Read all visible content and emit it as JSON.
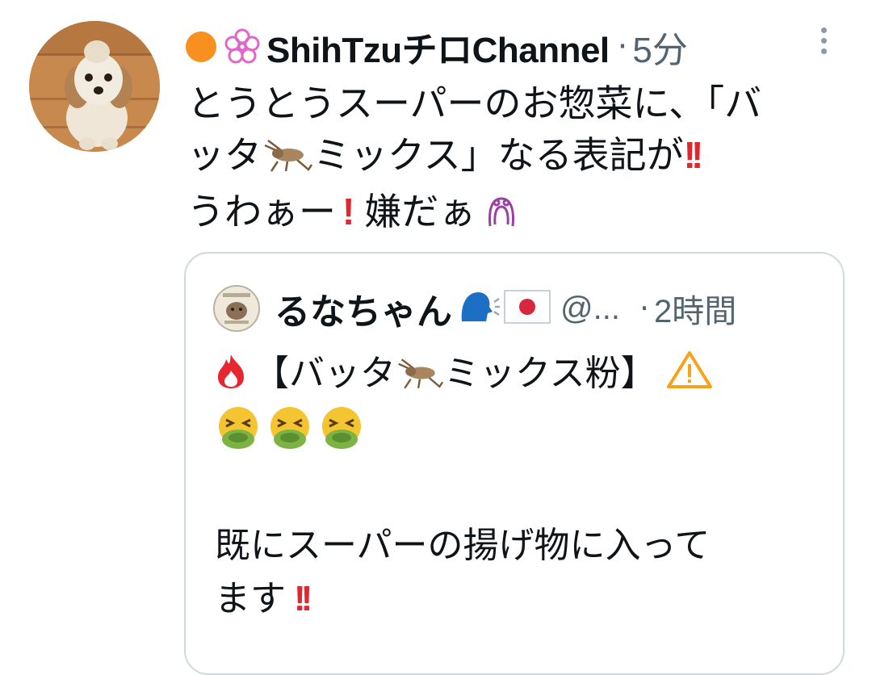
{
  "tweet": {
    "display_name": "ShihTzuチロChannel",
    "separator": "·",
    "time": "5分",
    "body_lines": [
      {
        "before": "とうとうスーパーのお惣菜に、「バ",
        "after": ""
      },
      {
        "before": "ッタ",
        "after": "ミックス」なる表記が"
      },
      {
        "before": "うわぁー",
        "after": "嫌だぁ"
      }
    ],
    "emojis": [
      "orange-circle-emoji",
      "cherry-blossom-emoji",
      "cricket-emoji",
      "double-exclamation-emoji",
      "exclamation-emoji",
      "dizzy-face-outline-emoji"
    ]
  },
  "quoted_tweet": {
    "display_name": "るなちゃん",
    "handle": "@...",
    "separator": "·",
    "time": "2時間",
    "body_lines": [
      {
        "before": "【バッタ",
        "after": "ミックス粉】"
      },
      {
        "text": ""
      },
      {
        "text": ""
      },
      {
        "text": "既にスーパーの揚げ物に入って"
      },
      {
        "text": "ます"
      }
    ],
    "emojis": [
      "fire-emoji",
      "cricket-emoji",
      "warning-emoji",
      "nauseated-face-emoji",
      "speaking-head-emoji",
      "japan-flag-emoji",
      "double-exclamation-emoji"
    ]
  },
  "colors": {
    "text": "#0f1419",
    "secondary": "#536471",
    "border": "#cfd9de",
    "red_bang": "#e0262f",
    "warning": "#f7a21b"
  }
}
